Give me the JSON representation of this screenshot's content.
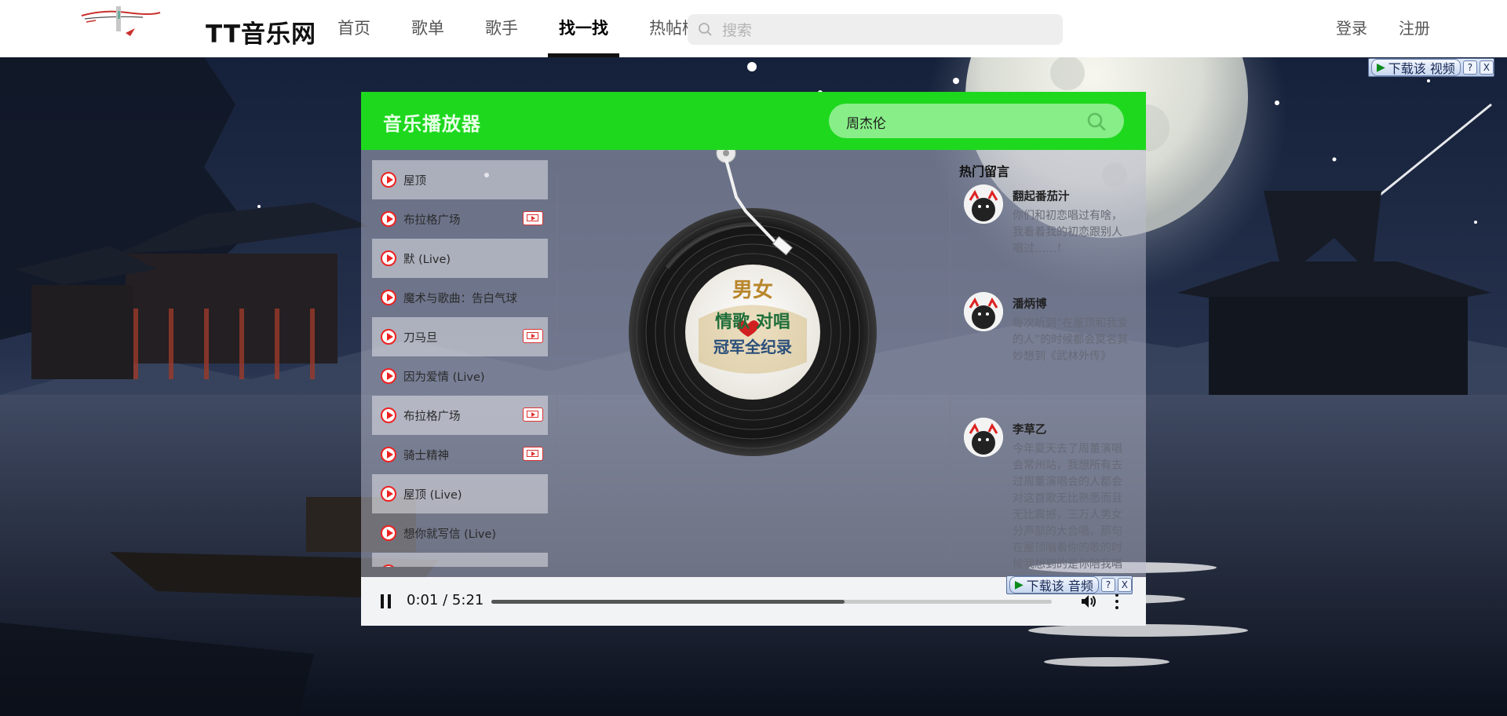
{
  "site": {
    "brand": "TT音乐网",
    "nav": [
      "首页",
      "歌单",
      "歌手",
      "找一找",
      "热帖榜"
    ],
    "active_nav": "找一找",
    "search_placeholder": "搜索",
    "login": "登录",
    "register": "注册"
  },
  "download_badges": {
    "video": {
      "label": "下载该 视频",
      "help": "?",
      "close": "X"
    },
    "audio": {
      "label": "下载该 音频",
      "help": "?",
      "close": "X"
    }
  },
  "player": {
    "title": "音乐播放器",
    "search_value": "周杰伦",
    "songs": [
      {
        "name": "屋顶",
        "has_mv": false
      },
      {
        "name": "布拉格广场",
        "has_mv": true
      },
      {
        "name": "默 (Live)",
        "has_mv": false
      },
      {
        "name": "魔术与歌曲：告白气球",
        "has_mv": false
      },
      {
        "name": "刀马旦",
        "has_mv": true
      },
      {
        "name": "因为爱情 (Live)",
        "has_mv": false
      },
      {
        "name": "布拉格广场",
        "has_mv": true
      },
      {
        "name": "骑士精神",
        "has_mv": true
      },
      {
        "name": "屋顶 (Live)",
        "has_mv": false
      },
      {
        "name": "想你就写信 (Live)",
        "has_mv": false
      }
    ],
    "album_art_text": {
      "top": "男女",
      "middle": "情歌 对唱",
      "bottom": "冠军全纪录"
    },
    "comments_title": "热门留言",
    "comments": [
      {
        "user": "翻起番茄汁",
        "text": "你们和初恋唱过有啥，我看着我的初恋跟别人唱过……！"
      },
      {
        "user": "潘炳博",
        "text": "每次听到“在屋顶和我爱的人”的时候都会莫名其妙想到《武林外传》"
      },
      {
        "user": "李草乙",
        "text": "今年夏天去了周董演唱会常州站，我想所有去过周董演唱会的人都会对这首歌无比熟悉而且无比震撼，三万人男女分声部的大合唱，那句在屋顶唱着你的歌的时候我想到的是你陪我唱"
      }
    ],
    "time_display": "0:01 / 5:21",
    "buffered_fraction": 0.63,
    "played_fraction": 0.003
  },
  "colors": {
    "header_green": "#1ed81e",
    "search_green": "#88ee88",
    "play_red": "#ee2222"
  },
  "icons": [
    "search-icon",
    "play-circle-icon",
    "mv-icon",
    "pause-icon",
    "volume-icon",
    "more-vert-icon"
  ]
}
